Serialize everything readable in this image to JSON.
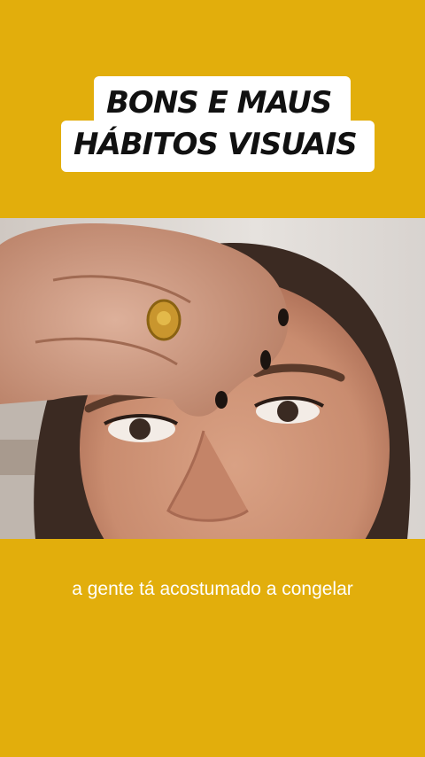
{
  "title": {
    "line1": "BONS E MAUS",
    "line2": "HÁBITOS VISUAIS"
  },
  "caption": "a gente tá acostumado a congelar",
  "colors": {
    "background": "#e2ae0c",
    "title_box": "#ffffff",
    "title_text": "#111111",
    "caption_text": "#ffffff"
  }
}
